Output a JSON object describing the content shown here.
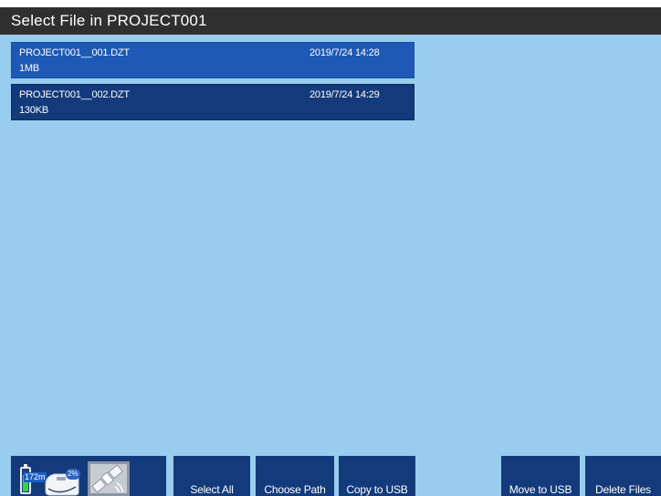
{
  "title": "Select File in PROJECT001",
  "files": [
    {
      "name": "PROJECT001__001.DZT",
      "date": "2019/7/24 14:28",
      "size": "1MB",
      "selected": true
    },
    {
      "name": "PROJECT001__002.DZT",
      "date": "2019/7/24 14:29",
      "size": "130KB",
      "selected": false
    }
  ],
  "status": {
    "battery_label": "172m",
    "battery_level": 0.7,
    "storage_label": "2%",
    "icons": [
      "battery-icon",
      "storage-icon",
      "gps-satellite-icon"
    ]
  },
  "buttons": {
    "select_all": "Select All",
    "choose_path": "Choose Path",
    "copy_to_usb": "Copy to USB",
    "move_to_usb": "Move to USB",
    "delete_files": "Delete Files"
  },
  "colors": {
    "background": "#99cdef",
    "title_bar": "#2f2f2f",
    "row_selected": "#1e59b5",
    "row_normal": "#133a7a",
    "button": "#133a7a",
    "battery_fill": "#2fd64a"
  }
}
